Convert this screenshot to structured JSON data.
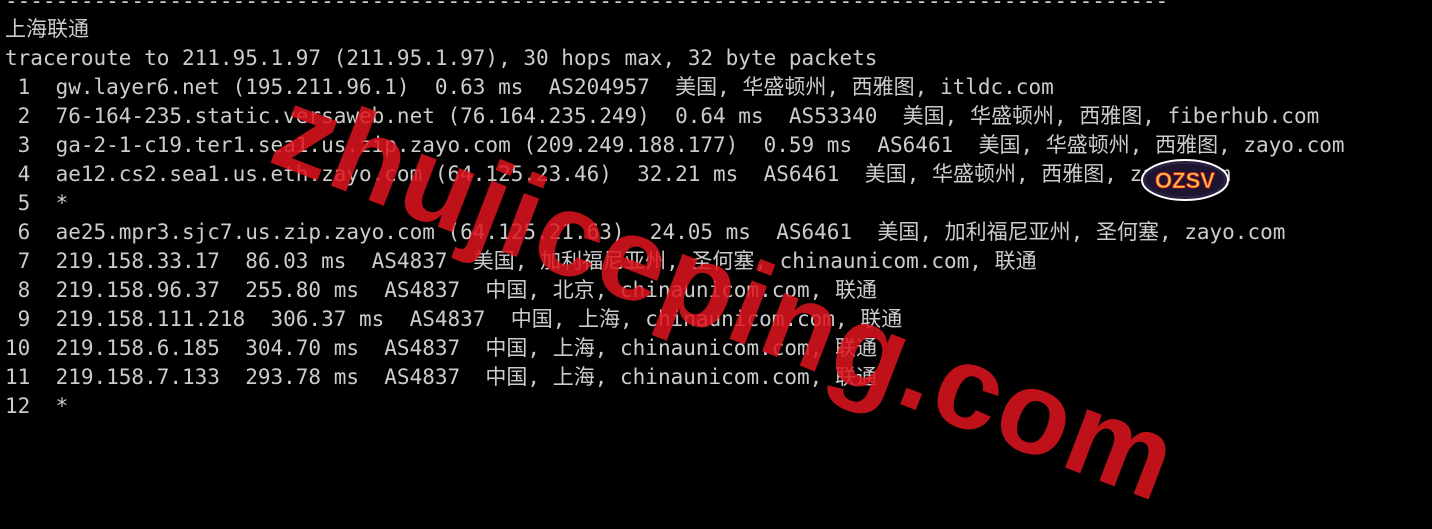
{
  "terminal": {
    "lines": [
      "--------------------------------------------------------------------------------------------",
      "上海联通",
      "traceroute to 211.95.1.97 (211.95.1.97), 30 hops max, 32 byte packets",
      " 1  gw.layer6.net (195.211.96.1)  0.63 ms  AS204957  美国, 华盛顿州, 西雅图, itldc.com",
      " 2  76-164-235.static.versaweb.net (76.164.235.249)  0.64 ms  AS53340  美国, 华盛顿州, 西雅图, fiberhub.com",
      " 3  ga-2-1-c19.ter1.sea1.us.zip.zayo.com (209.249.188.177)  0.59 ms  AS6461  美国, 华盛顿州, 西雅图, zayo.com",
      " 4  ae12.cs2.sea1.us.eth.zayo.com (64.125.23.46)  32.21 ms  AS6461  美国, 华盛顿州, 西雅图, zayo.com",
      " 5  *",
      " 6  ae25.mpr3.sjc7.us.zip.zayo.com (64.125.21.63)  24.05 ms  AS6461  美国, 加利福尼亚州, 圣何塞, zayo.com",
      " 7  219.158.33.17  86.03 ms  AS4837  美国, 加利福尼亚州, 圣何塞, chinaunicom.com, 联通",
      " 8  219.158.96.37  255.80 ms  AS4837  中国, 北京, chinaunicom.com, 联通",
      " 9  219.158.111.218  306.37 ms  AS4837  中国, 上海, chinaunicom.com, 联通",
      "10  219.158.6.185  304.70 ms  AS4837  中国, 上海, chinaunicom.com, 联通",
      "11  219.158.7.133  293.78 ms  AS4837  中国, 上海, chinaunicom.com, 联通",
      "12  *"
    ]
  },
  "watermark": {
    "text": "zhujiceping.com",
    "color": "#e0141e"
  },
  "logo": {
    "text": "OZSV"
  }
}
